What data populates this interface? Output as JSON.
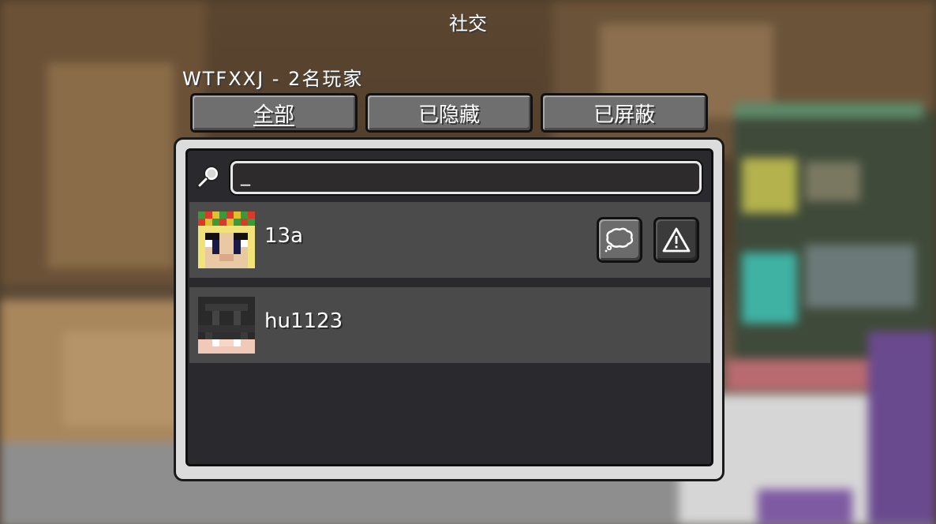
{
  "screen": {
    "title": "社交",
    "server_line": "WTFXXJ - 2名玩家"
  },
  "tabs": [
    {
      "label": "全部",
      "active": true
    },
    {
      "label": "已隐藏",
      "active": false
    },
    {
      "label": "已屏蔽",
      "active": false
    }
  ],
  "search": {
    "value": "_",
    "icon": "magnifier-icon"
  },
  "players": [
    {
      "name": "13a",
      "avatar": "player-head-blonde-flower-crown",
      "actions": [
        "chat-icon",
        "report-icon"
      ]
    },
    {
      "name": "hu1123",
      "avatar": "player-head-dark-hair"
    }
  ],
  "colors": {
    "panel_bg": "#2a2a2e",
    "row_bg": "#4a4a4a",
    "button_bg": "#6f6f6f",
    "text": "#ffffff"
  }
}
